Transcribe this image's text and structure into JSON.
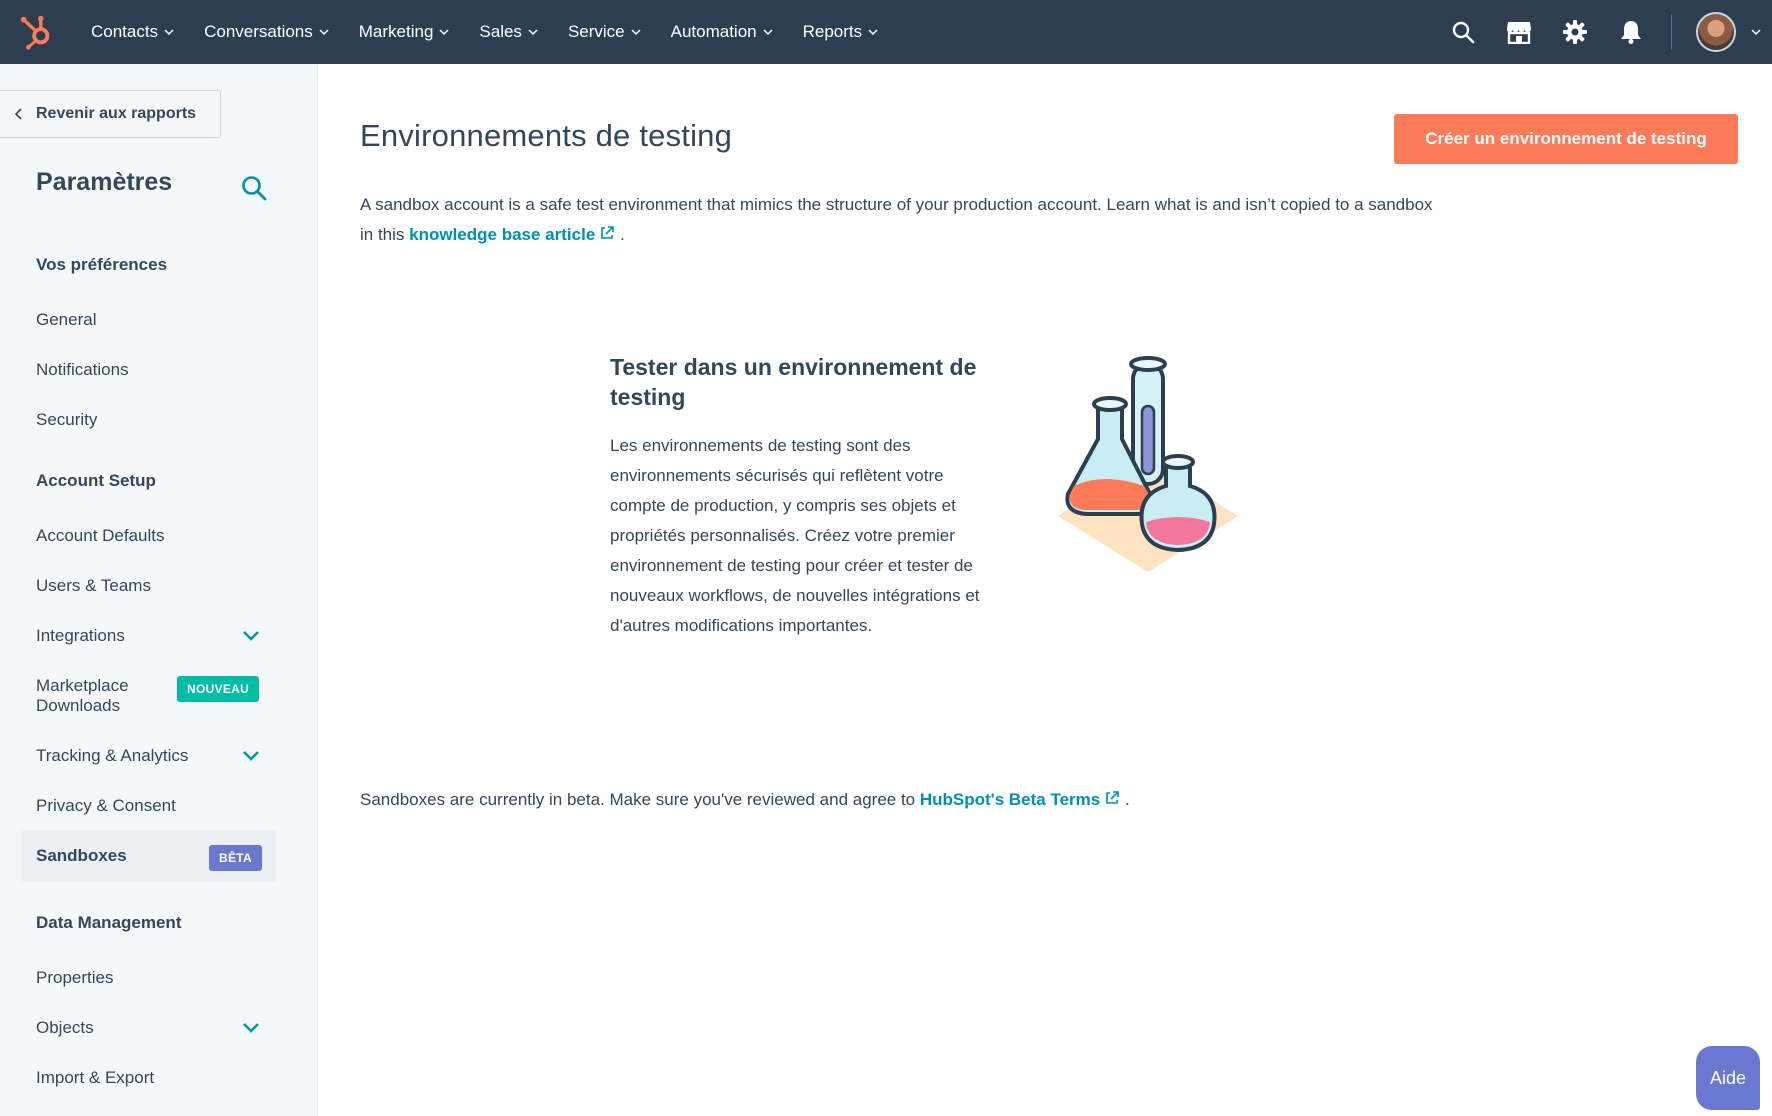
{
  "nav": {
    "items": [
      {
        "label": "Contacts"
      },
      {
        "label": "Conversations"
      },
      {
        "label": "Marketing"
      },
      {
        "label": "Sales"
      },
      {
        "label": "Service"
      },
      {
        "label": "Automation"
      },
      {
        "label": "Reports"
      }
    ],
    "icons": [
      "search-icon",
      "marketplace-icon",
      "gear-icon",
      "bell-icon",
      "avatar"
    ]
  },
  "sidebar": {
    "back_label": "Revenir aux rapports",
    "title": "Paramètres",
    "sections": {
      "preferences": "Vos préférences",
      "account_setup": "Account Setup",
      "data_management": "Data Management"
    },
    "items": {
      "general": "General",
      "notifications": "Notifications",
      "security": "Security",
      "account_defaults": "Account Defaults",
      "users_teams": "Users & Teams",
      "integrations": "Integrations",
      "marketplace_line1": "Marketplace",
      "marketplace_line2": "Downloads",
      "tracking": "Tracking & Analytics",
      "privacy": "Privacy & Consent",
      "sandboxes": "Sandboxes",
      "properties": "Properties",
      "objects": "Objects",
      "import_export": "Import & Export"
    },
    "badges": {
      "new": "NOUVEAU",
      "beta": "BÊTA"
    }
  },
  "main": {
    "title": "Environnements de testing",
    "create_button": "Créer un environnement de testing",
    "intro_text": "A sandbox account is a safe test environment that mimics the structure of your production account. Learn what is and isn’t copied to a sandbox in this ",
    "intro_link": "knowledge base article",
    "intro_end": ".",
    "card_title": "Tester dans un environnement de testing",
    "card_text": "Les environnements de testing sont des environnements sécurisés qui reflètent votre compte de production, y compris ses objets et propriétés personnalisés. Créez votre premier environnement de testing pour créer et tester de nouveaux workflows, de nouvelles intégrations et d'autres modifications importantes.",
    "beta_text": "Sandboxes are currently in beta. Make sure you've reviewed and agree to ",
    "beta_link": "HubSpot's Beta Terms",
    "beta_end": "."
  },
  "help": {
    "label": "Aide"
  },
  "colors": {
    "nav_bg": "#2d3e50",
    "primary": "#ff7a59",
    "link": "#0091ae",
    "badge_new": "#00bda5",
    "badge_beta": "#6a78d1",
    "text": "#33475b"
  }
}
